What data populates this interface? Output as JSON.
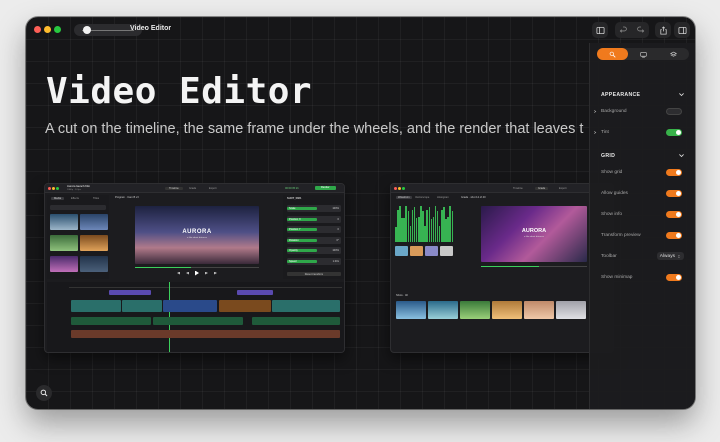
{
  "window": {
    "title": "Video Editor"
  },
  "hero": {
    "title": "Video Editor",
    "subtitle": "A cut on the timeline, the same frame under the wheels, and the render that leaves t"
  },
  "toolbar": {
    "icons": [
      "sidebar-icon",
      "undo-icon",
      "redo-icon",
      "share-icon",
      "inspector-icon"
    ]
  },
  "panel": {
    "tabs": [
      "brush-icon",
      "display-icon",
      "layers-icon"
    ],
    "active_tab": 0,
    "appearance": {
      "heading": "APPEARANCE",
      "rows": [
        {
          "label": "Background",
          "state": "off"
        },
        {
          "label": "Tint",
          "state": "green"
        }
      ]
    },
    "grid": {
      "heading": "GRID",
      "rows": [
        {
          "label": "Show grid",
          "state": "on"
        },
        {
          "label": "Allow guides",
          "state": "on"
        },
        {
          "label": "Show info",
          "state": "on"
        },
        {
          "label": "Transform preview",
          "state": "on"
        }
      ],
      "toolbar_label": "Toolbar",
      "toolbar_value": "Always",
      "minimap_label": "Show minimap",
      "minimap_state": "on"
    }
  },
  "preview_left": {
    "project": "Aurora launch film",
    "project_sub": "1080p · 24 fps",
    "tabs": [
      "Timeline",
      "Grade",
      "Export"
    ],
    "timecode": "00:00:05:21",
    "render_label": "Render",
    "media_tabs": [
      "Media",
      "Effects",
      "Titles"
    ],
    "program_label": "Program · Cam B v3",
    "viewer_title": "AURORA",
    "viewer_sub": "a film about distance",
    "inspector_title": "SHOT_0821",
    "inspector_rows": [
      "Scale",
      "Position X",
      "Position Y",
      "Rotation",
      "Opacity",
      "Speed"
    ],
    "inspector_values": [
      "100%",
      "0",
      "0",
      "0°",
      "100%",
      "1.00x"
    ],
    "inspector_button": "Reset transform",
    "clips": [
      "Title – Aurora",
      "Shot_0821",
      "Shot_0822",
      "Shot_0823",
      "Shot_0824",
      "VO_take_03",
      "VO_take_04",
      "Score_v2"
    ]
  },
  "preview_right": {
    "tabs": [
      "Timeline",
      "Grade",
      "Export"
    ],
    "panel_tabs": [
      "Waveform",
      "Vectorscope",
      "Histogram"
    ],
    "program_label": "Grade · shot 12 of 40",
    "viewer_title": "AURORA",
    "viewer_sub": "a film about distance",
    "strip_label": "Shots · 40"
  }
}
